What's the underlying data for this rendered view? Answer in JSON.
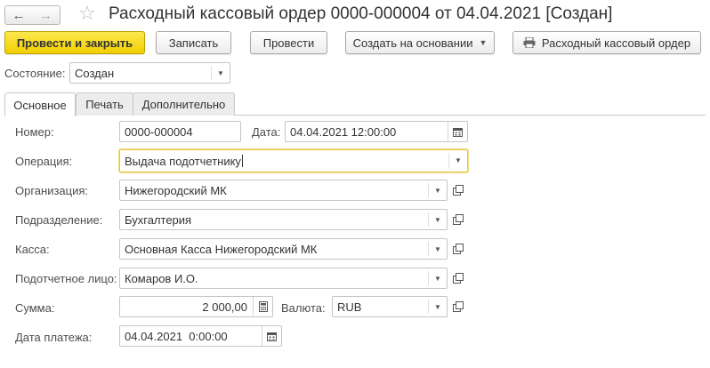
{
  "window": {
    "title": "Расходный кассовый ордер 0000-000004 от 04.04.2021 [Создан]"
  },
  "toolbar": {
    "post_and_close": "Провести и закрыть",
    "save": "Записать",
    "post": "Провести",
    "create_based_on": "Создать на основании",
    "print_order": "Расходный кассовый ордер"
  },
  "status": {
    "label": "Состояние:",
    "value": "Создан"
  },
  "tabs": [
    {
      "label": "Основное",
      "active": true
    },
    {
      "label": "Печать",
      "active": false
    },
    {
      "label": "Дополнительно",
      "active": false
    }
  ],
  "form": {
    "number": {
      "label": "Номер:",
      "value": "0000-000004"
    },
    "date": {
      "label": "Дата:",
      "value": "04.04.2021 12:00:00"
    },
    "operation": {
      "label": "Операция:",
      "value": "Выдача подотчетнику"
    },
    "organization": {
      "label": "Организация:",
      "value": "Нижегородский МК"
    },
    "department": {
      "label": "Подразделение:",
      "value": "Бухгалтерия"
    },
    "cashbox": {
      "label": "Касса:",
      "value": "Основная Касса Нижегородский МК"
    },
    "accountable_person": {
      "label": "Подотчетное лицо:",
      "value": "Комаров И.О."
    },
    "amount": {
      "label": "Сумма:",
      "value": "2 000,00"
    },
    "currency": {
      "label": "Валюта:",
      "value": "RUB"
    },
    "payment_date": {
      "label": "Дата платежа:",
      "value": "04.04.2021  0:00:00"
    }
  },
  "icons": {
    "back": "arrow-left-icon",
    "forward": "arrow-right-icon",
    "favorite": "star-icon",
    "printer": "printer-icon",
    "calendar": "calendar-icon",
    "calculator": "calculator-icon",
    "open": "open-form-icon",
    "dropdown": "chevron-down-icon"
  },
  "colors": {
    "primary_button": "#f2cf00",
    "focus_border": "#e8c64a"
  }
}
